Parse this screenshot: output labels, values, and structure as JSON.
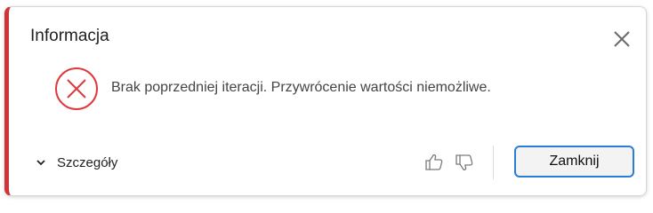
{
  "dialog": {
    "title": "Informacja",
    "message": "Brak poprzedniej iteracji. Przywrócenie wartości niemożliwe.",
    "details_label": "Szczegóły",
    "close_label": "Zamknij",
    "icons": {
      "close": "close-icon",
      "error": "error-circle-x-icon",
      "details": "chevron-down-icon",
      "like": "thumbs-up-icon",
      "dislike": "thumbs-down-icon"
    },
    "colors": {
      "accent_error": "#d13438",
      "button_border": "#2b7cd3"
    }
  }
}
